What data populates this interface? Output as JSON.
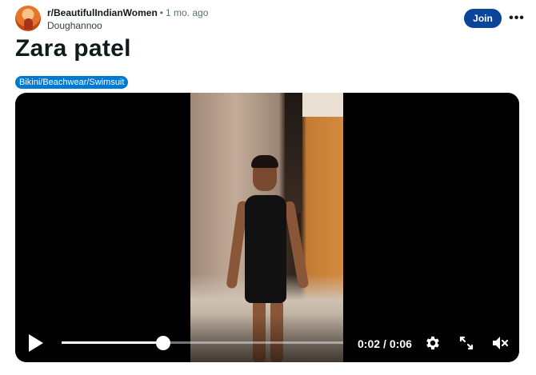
{
  "post": {
    "subreddit": "r/BeautifulIndianWomen",
    "separator": "•",
    "age": "1 mo. ago",
    "author": "Doughannoo",
    "join_label": "Join",
    "more_label": "•••",
    "title": "Zara patel",
    "flair": "Bikini/Beachwear/Swimsuit"
  },
  "video": {
    "current_time": "0:02",
    "time_separator": "/",
    "duration": "0:06",
    "progress_fraction": 0.36,
    "muted": true
  },
  "colors": {
    "join_button": "#0a449b",
    "flair_background": "#0079d3",
    "player_background": "#000000"
  },
  "icons": {
    "avatar": "subreddit-avatar",
    "play": "play-icon",
    "settings": "gear-icon",
    "fullscreen": "expand-icon",
    "volume": "volume-muted-icon"
  }
}
